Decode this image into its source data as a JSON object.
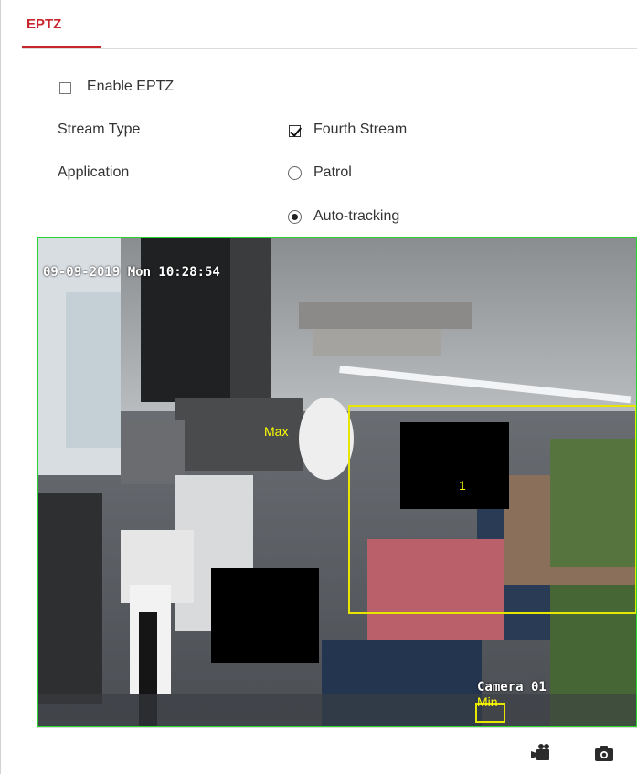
{
  "tab": {
    "label": "EPTZ"
  },
  "form": {
    "enable": {
      "label": "Enable EPTZ",
      "checked": false
    },
    "stream_type": {
      "label": "Stream Type",
      "option_label": "Fourth Stream",
      "checked": true
    },
    "application": {
      "label": "Application",
      "options": [
        {
          "label": "Patrol",
          "selected": false
        },
        {
          "label": "Auto-tracking",
          "selected": true
        }
      ]
    }
  },
  "video": {
    "timestamp": "09-09-2019 Mon 10:28:54",
    "camera_name": "Camera 01",
    "max_label": "Max",
    "min_label": "Min",
    "region_number": "1",
    "border_color": "#2ed22e",
    "region_color": "#ffff00"
  },
  "toolbar": {
    "icons": [
      "record-icon",
      "snapshot-icon"
    ]
  }
}
